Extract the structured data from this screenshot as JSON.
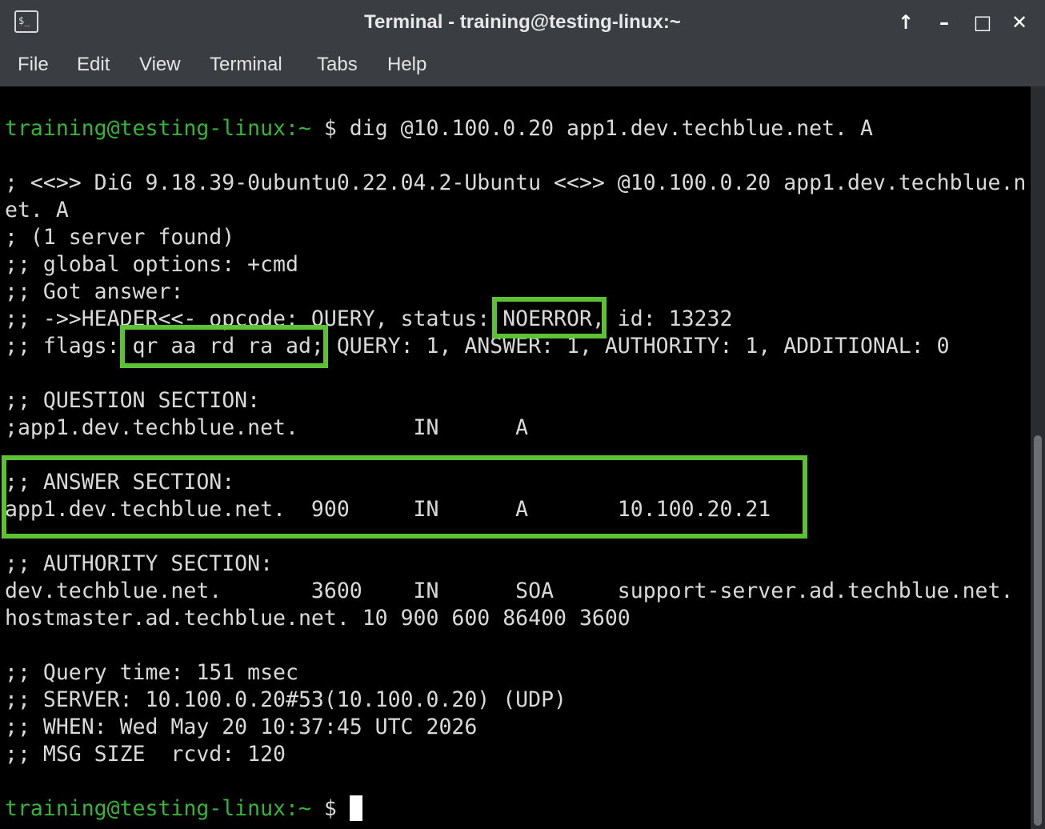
{
  "window": {
    "title": "Terminal - training@testing-linux:~",
    "controls": {
      "maximize_up": "↑",
      "minimize": "–",
      "restore": "□",
      "close": "✕"
    },
    "icon": "terminal-icon",
    "icon_glyph": "$_"
  },
  "menu": [
    "File",
    "Edit",
    "View",
    "Terminal",
    "Tabs",
    "Help"
  ],
  "terminal": {
    "prompt_user": "training@testing-linux",
    "prompt_path": ":~",
    "prompt_symbol": " $ ",
    "command": "dig @10.100.0.20 app1.dev.techblue.net. A",
    "lines": [
      "; <<>> DiG 9.18.39-0ubuntu0.22.04.2-Ubuntu <<>> @10.100.0.20 app1.dev.techblue.n",
      "et. A",
      "; (1 server found)",
      ";; global options: +cmd",
      ";; Got answer:",
      ";; ->>HEADER<<- opcode: QUERY, status: NOERROR, id: 13232",
      ";; flags: qr aa rd ra ad; QUERY: 1, ANSWER: 1, AUTHORITY: 1, ADDITIONAL: 0",
      "",
      ";; QUESTION SECTION:",
      ";app1.dev.techblue.net.         IN      A",
      "",
      ";; ANSWER SECTION:",
      "app1.dev.techblue.net.  900     IN      A       10.100.20.21",
      "",
      ";; AUTHORITY SECTION:",
      "dev.techblue.net.       3600    IN      SOA     support-server.ad.techblue.net.",
      "hostmaster.ad.techblue.net. 10 900 600 86400 3600",
      "",
      ";; Query time: 151 msec",
      ";; SERVER: 10.100.0.20#53(10.100.0.20) (UDP)",
      ";; WHEN: Wed May 20 10:37:45 UTC 2026",
      ";; MSG SIZE  rcvd: 120",
      ""
    ]
  },
  "colors": {
    "prompt": "#35b535",
    "highlight_box": "#5cc234",
    "text": "#d9d9d9",
    "background": "#000000"
  }
}
